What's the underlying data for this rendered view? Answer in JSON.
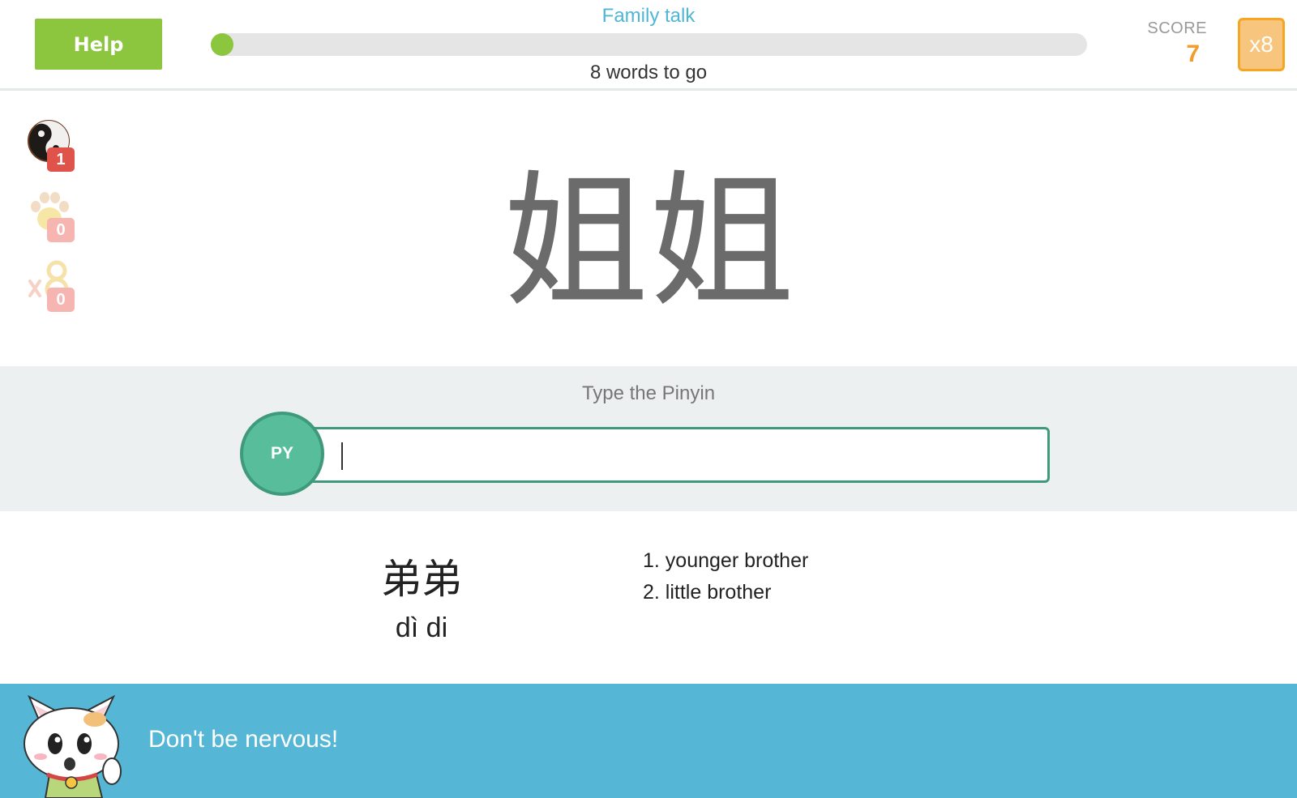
{
  "header": {
    "help_label": "Help",
    "lesson_title": "Family talk",
    "progress_fraction": 0.0,
    "words_to_go": "8 words to go",
    "score_label": "SCORE",
    "score_value": "7",
    "multiplier": "x8"
  },
  "powerups": [
    {
      "name": "yin-yang",
      "count": "1",
      "active": true
    },
    {
      "name": "paw",
      "count": "0",
      "active": false
    },
    {
      "name": "multiplier-x8",
      "count": "0",
      "active": false
    }
  ],
  "question": {
    "character": "姐姐"
  },
  "answer": {
    "prompt": "Type the Pinyin",
    "mode_badge": "PY",
    "input_value": "",
    "input_placeholder": ""
  },
  "previous_word": {
    "hanzi": "弟弟",
    "pinyin": "dì di",
    "definitions": [
      "1. younger brother",
      "2. little brother"
    ]
  },
  "banner": {
    "message": "Don't be nervous!"
  },
  "colors": {
    "help_green": "#8cc63f",
    "title_blue": "#4eb6d6",
    "score_orange": "#f39c2b",
    "input_teal": "#3f9a7c",
    "badge_teal": "#58bd9b",
    "banner_blue": "#55b7d5",
    "badge_red": "#e0534a"
  }
}
